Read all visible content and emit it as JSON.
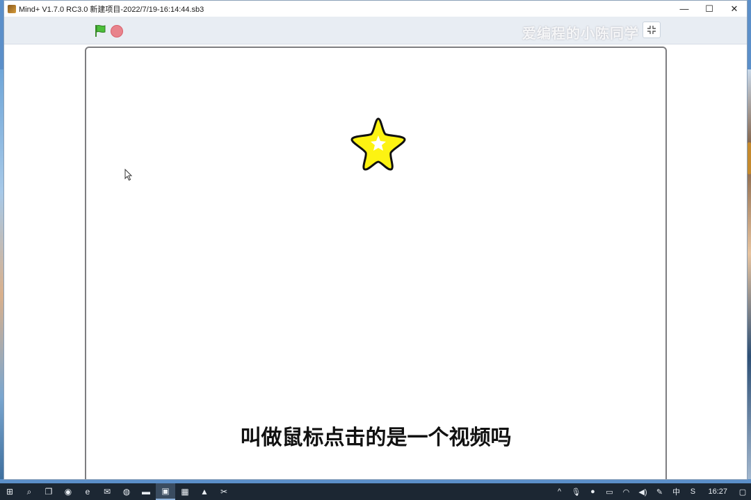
{
  "window": {
    "title": "Mind+  V1.7.0 RC3.0   新建项目-2022/7/19-16:14:44.sb3",
    "minimize": "—",
    "maximize": "☐",
    "close": "✕"
  },
  "toolbar": {
    "green_flag_icon": "flag-icon",
    "stop_icon": "stop-icon",
    "fullscreen_icon": "fullscreen-exit-icon",
    "watermark": "爱编程的小陈同学"
  },
  "stage": {
    "sprite": "star",
    "subtitle": "叫做鼠标点击的是一个视频吗"
  },
  "taskbar": {
    "items": [
      {
        "name": "windows-start-icon",
        "glyph": "⊞"
      },
      {
        "name": "search-icon",
        "glyph": "⌕"
      },
      {
        "name": "task-view-icon",
        "glyph": "❐"
      },
      {
        "name": "network-app-icon",
        "glyph": "◉"
      },
      {
        "name": "edge-icon",
        "glyph": "e"
      },
      {
        "name": "wechat-icon",
        "glyph": "✉"
      },
      {
        "name": "chrome-icon",
        "glyph": "◍"
      },
      {
        "name": "file-explorer-icon",
        "glyph": "▬"
      },
      {
        "name": "mindplus-icon",
        "glyph": "▣"
      },
      {
        "name": "app-window-icon",
        "glyph": "▦"
      },
      {
        "name": "app-triangle-icon",
        "glyph": "▲"
      },
      {
        "name": "capcut-icon",
        "glyph": "✂"
      }
    ],
    "tray": {
      "chevron": "^",
      "mic": "🎙",
      "app": "●",
      "battery": "▭",
      "wifi": "◠",
      "volume": "◀)",
      "pen": "✎",
      "ime": "中",
      "sogou": "S",
      "time": "16:27",
      "notifications": "▢"
    }
  }
}
